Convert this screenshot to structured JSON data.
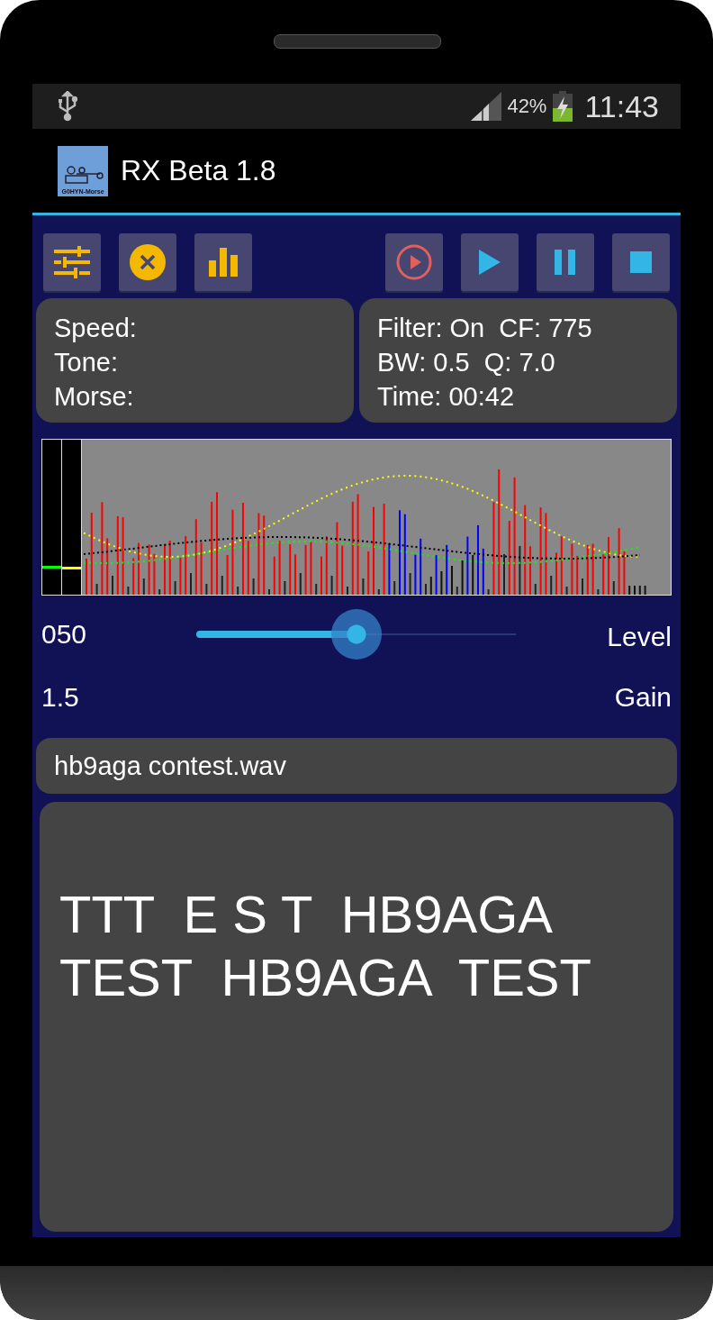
{
  "status_bar": {
    "battery": "42%",
    "time": "11:43"
  },
  "action_bar": {
    "logo_text": "G0HYN-Morse",
    "title": "RX Beta 1.8"
  },
  "toolbar": {
    "left": [
      {
        "kind": "settings"
      },
      {
        "kind": "clear"
      },
      {
        "kind": "chart"
      }
    ],
    "right": [
      {
        "kind": "record"
      },
      {
        "kind": "play"
      },
      {
        "kind": "pause"
      },
      {
        "kind": "stop"
      }
    ]
  },
  "info_left": [
    "Speed:",
    "Tone:",
    "Morse:"
  ],
  "info_right": [
    "Filter: On  CF: 775",
    "BW: 0.5  Q: 7.0",
    "Time: 00:42"
  ],
  "level_row": {
    "value": "050",
    "label": "Level",
    "level": 0.5
  },
  "gain_row": {
    "value": "1.5",
    "label": "Gain"
  },
  "file_name": "hb9aga contest.wav",
  "decoded_lines": [
    "TTT  E S T  HB9AGA",
    "TEST  HB9AGA  TEST"
  ]
}
